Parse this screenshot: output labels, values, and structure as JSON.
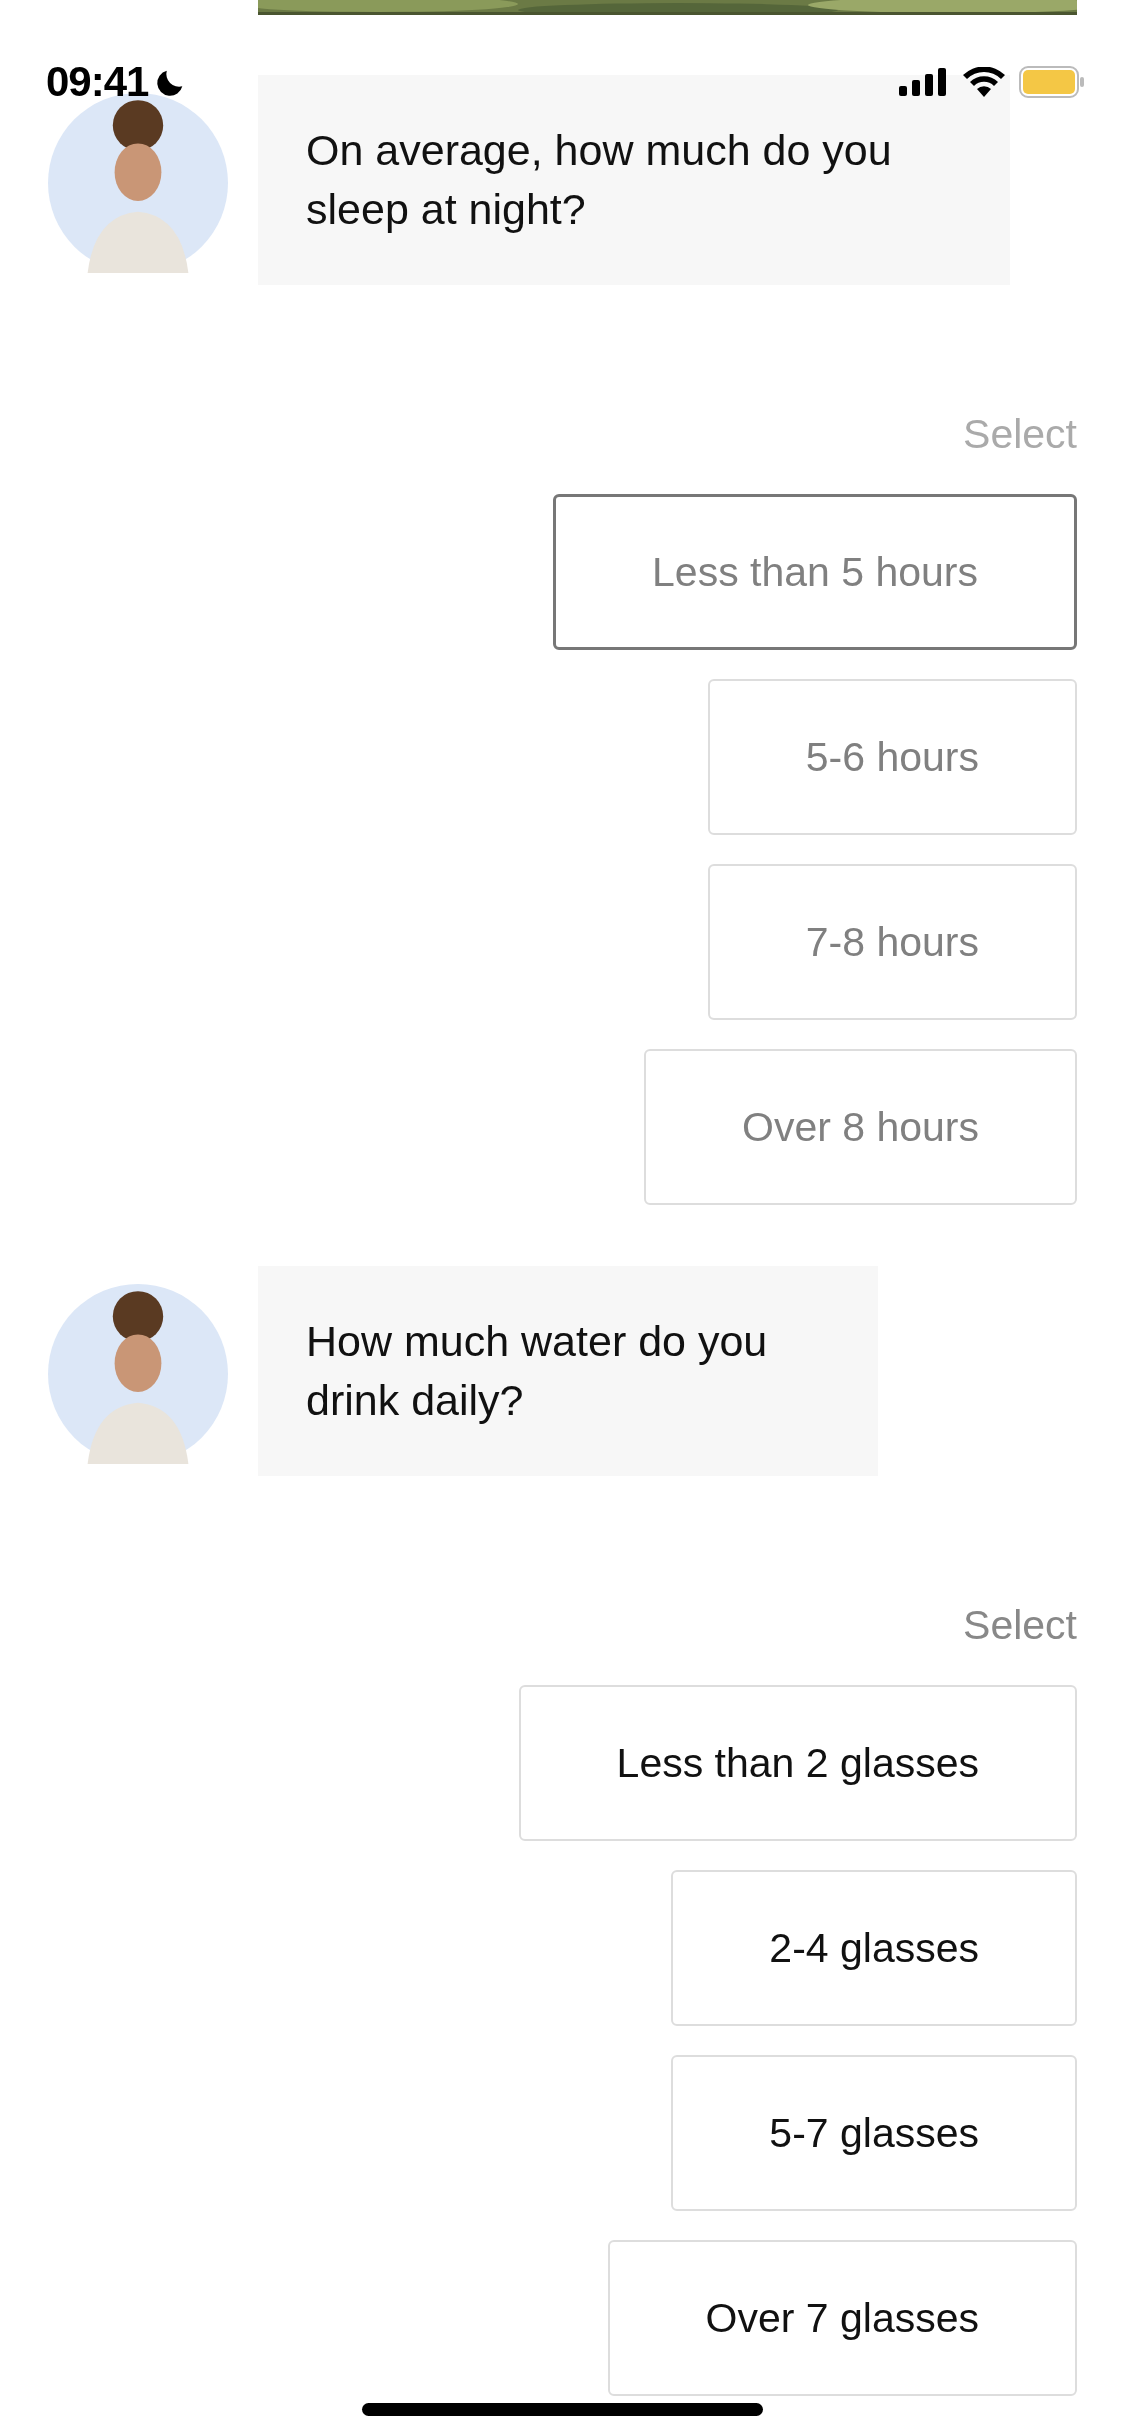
{
  "status_bar": {
    "time": "09:41"
  },
  "questions": [
    {
      "text": "On average, how much do you sleep at night?",
      "prompt": "Select",
      "answered": true,
      "options": [
        {
          "label": "Less than 5 hours",
          "selected": true
        },
        {
          "label": "5-6 hours",
          "selected": false
        },
        {
          "label": "7-8 hours",
          "selected": false
        },
        {
          "label": "Over 8 hours",
          "selected": false
        }
      ]
    },
    {
      "text": "How much water do you drink daily?",
      "prompt": "Select",
      "answered": false,
      "options": [
        {
          "label": "Less than 2 glasses",
          "selected": false
        },
        {
          "label": "2-4 glasses",
          "selected": false
        },
        {
          "label": "5-7 glasses",
          "selected": false
        },
        {
          "label": "Over 7 glasses",
          "selected": false
        }
      ]
    }
  ]
}
